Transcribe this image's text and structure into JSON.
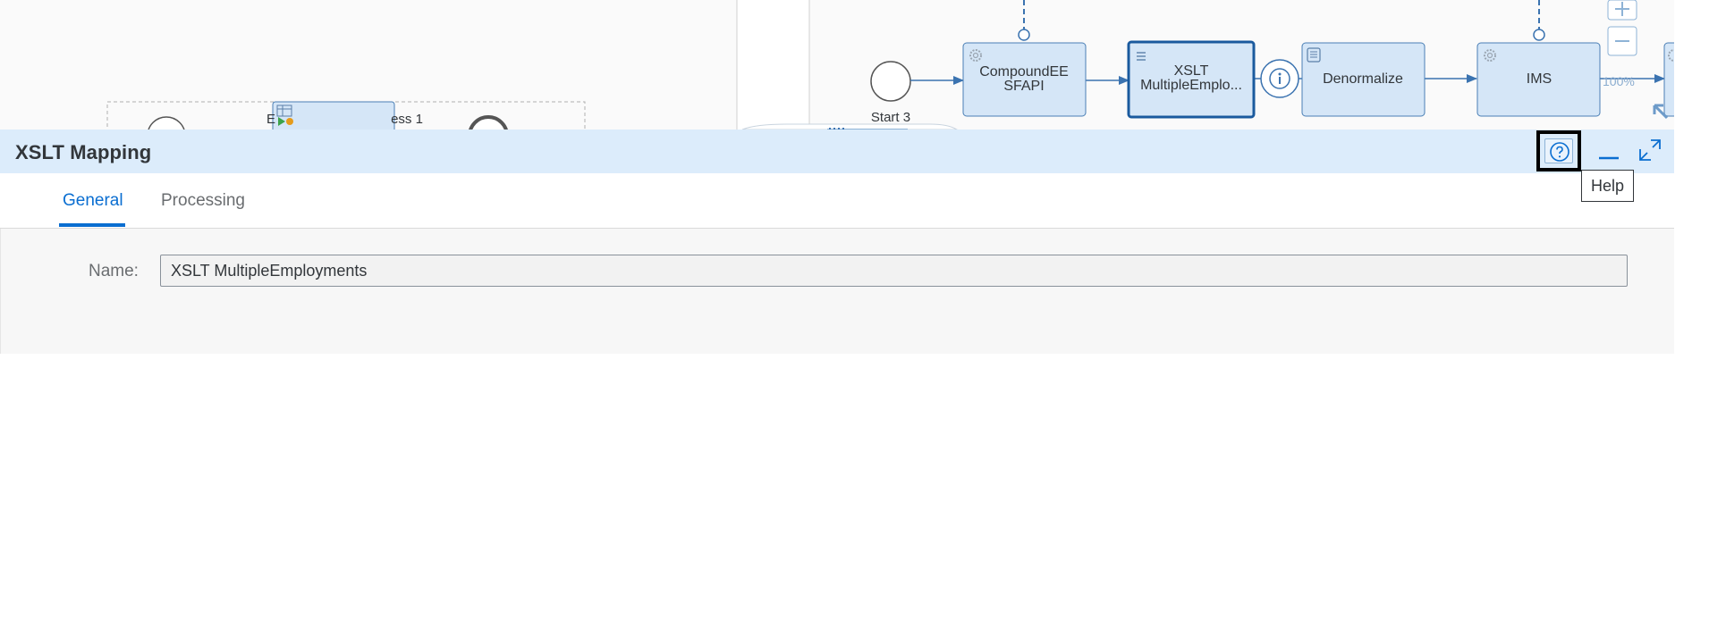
{
  "canvas": {
    "left_pool": {
      "label_fragment": "E",
      "label_suffix": "ess 1"
    },
    "nodes": {
      "start": "Start 3",
      "compound_line1": "CompoundEE",
      "compound_line2": "SFAPI",
      "xslt_line1": "XSLT",
      "xslt_line2": "MultipleEmplo...",
      "denormalize": "Denormalize",
      "ims": "IMS"
    },
    "zoom_level": "100%"
  },
  "panel": {
    "title": "XSLT Mapping",
    "help_tooltip": "Help"
  },
  "tabs": [
    {
      "label": "General",
      "active": true
    },
    {
      "label": "Processing",
      "active": false
    }
  ],
  "general": {
    "name_label": "Name:",
    "name_value": "XSLT MultipleEmployments"
  },
  "colors": {
    "accent": "#0a6ed1",
    "header_bg": "#dcecfb",
    "node_fill": "#d5e6f7",
    "node_stroke": "#4a7fb5"
  },
  "icons": {
    "help": "help-circle-icon",
    "minimize": "minimize-icon",
    "expand": "expand-icon"
  }
}
